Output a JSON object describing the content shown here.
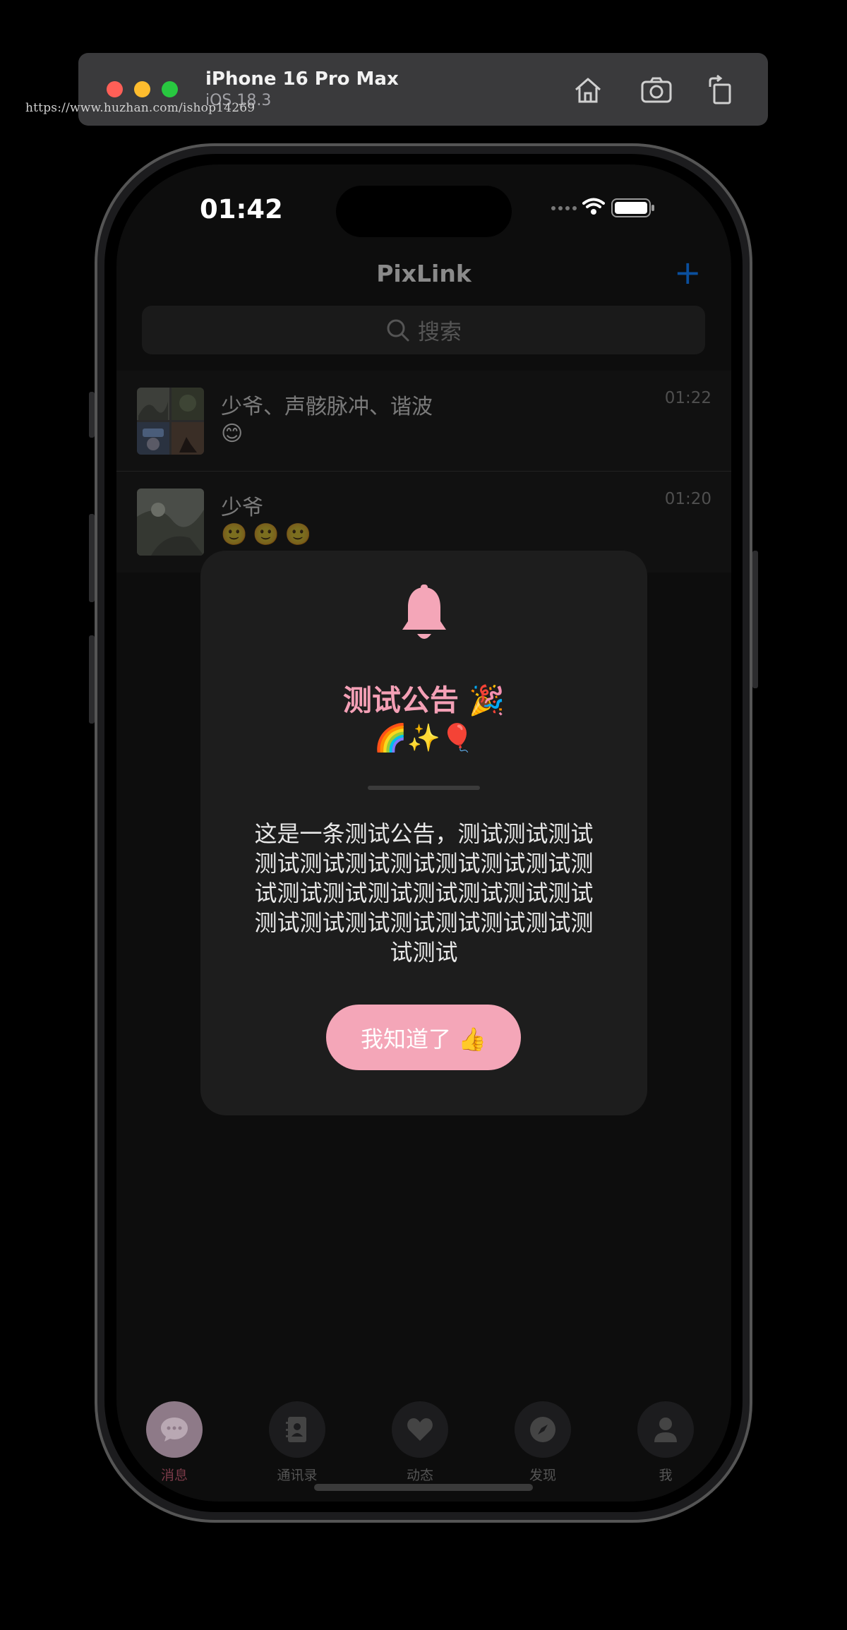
{
  "simulator": {
    "device_name": "iPhone 16 Pro Max",
    "os_version": "iOS 18.3",
    "watermark": "https://www.huzhan.com/ishop14269"
  },
  "status_bar": {
    "time": "01:42"
  },
  "header": {
    "title": "PixLink",
    "add_label": "+",
    "search_placeholder": "搜索"
  },
  "chats": [
    {
      "name": "少爷、声骸脉冲、谐波",
      "time": "01:22",
      "preview": "😊"
    },
    {
      "name": "少爷",
      "time": "01:20",
      "preview": "🙂🙂🙂"
    }
  ],
  "announcement": {
    "title": "测试公告 🎉",
    "emoji_line": "🌈✨🎈",
    "body": "这是一条测试公告，测试测试测试测试测试测试测试测试测试测试测试测试测试测试测试测试测试测试测试测试测试测试测试测试测试测试测试",
    "confirm_label": "我知道了 👍"
  },
  "tabs": [
    {
      "label": "消息",
      "icon": "chat-bubble-icon",
      "active": true
    },
    {
      "label": "通讯录",
      "icon": "contacts-book-icon",
      "active": false
    },
    {
      "label": "动态",
      "icon": "heart-icon",
      "active": false
    },
    {
      "label": "发现",
      "icon": "compass-icon",
      "active": false
    },
    {
      "label": "我",
      "icon": "person-icon",
      "active": false
    }
  ],
  "colors": {
    "accent_pink": "#f4a6b8",
    "title_pink": "#f4a0b6",
    "add_blue": "#0a4f9e",
    "modal_bg": "#1d1d1d"
  }
}
